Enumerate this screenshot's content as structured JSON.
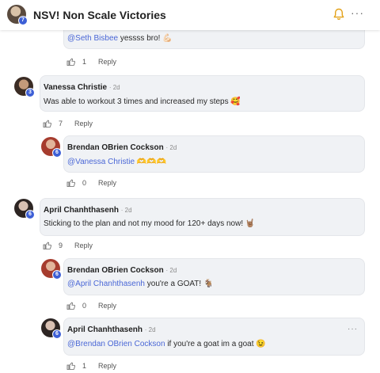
{
  "header": {
    "title": "NSV! Non Scale Victories",
    "avatar_badge": "7",
    "more": "···"
  },
  "top_reply": {
    "mention": "@Seth Bisbee",
    "text": " yessss bro! 💪🏻",
    "likes": "1",
    "reply_label": "Reply"
  },
  "comments": [
    {
      "author": "Vanessa Christie",
      "time": "· 2d",
      "badge": "3",
      "text": "Was able to workout 3 times and increased my steps 🥰",
      "likes": "7",
      "reply_label": "Reply",
      "replies": [
        {
          "author": "Brendan OBrien Cockson",
          "time": "· 2d",
          "badge": "6",
          "mention": "@Vanessa Christie",
          "text": " 🫶🫶🫶",
          "likes": "0",
          "reply_label": "Reply"
        }
      ]
    },
    {
      "author": "April Chanhthasenh",
      "time": "· 2d",
      "badge": "6",
      "text": "Sticking to the plan and not my mood for 120+ days now! 🤘🏽",
      "likes": "9",
      "reply_label": "Reply",
      "replies": [
        {
          "author": "Brendan OBrien Cockson",
          "time": "· 2d",
          "badge": "6",
          "mention": "@April Chanhthasenh",
          "text": " you're a GOAT! 🐐",
          "likes": "0",
          "reply_label": "Reply"
        },
        {
          "author": "April Chanhthasenh",
          "time": "· 2d",
          "badge": "6",
          "mention": "@Brendan OBrien Cockson",
          "text": " if you're a goat im a goat 😉",
          "likes": "1",
          "reply_label": "Reply",
          "more": "···"
        }
      ]
    }
  ],
  "colors": {
    "accent": "#4a67d6",
    "badge": "#3d5fd6",
    "bubble": "#f0f2f5",
    "bell": "#e3a117"
  }
}
